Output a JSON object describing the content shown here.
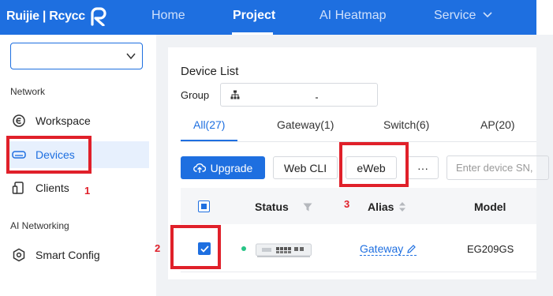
{
  "brand": {
    "logo_text": "Ruijie | Rcycc"
  },
  "topnav": {
    "items": [
      {
        "label": "Home",
        "active": false
      },
      {
        "label": "Project",
        "active": true
      },
      {
        "label": "AI Heatmap",
        "active": false
      },
      {
        "label": "Service",
        "active": false,
        "has_dropdown": true
      }
    ]
  },
  "sidebar": {
    "project_select_value": "",
    "section_network": "Network",
    "items": [
      {
        "label": "Workspace",
        "icon": "workspace-icon",
        "selected": false
      },
      {
        "label": "Devices",
        "icon": "devices-icon",
        "selected": true
      },
      {
        "label": "Clients",
        "icon": "clients-icon",
        "selected": false
      }
    ],
    "section_ai": "AI Networking",
    "ai_items": [
      {
        "label": "Smart Config",
        "icon": "smart-config-icon"
      }
    ]
  },
  "main": {
    "title": "Device List",
    "group_label": "Group",
    "group_value": "",
    "tabs": [
      {
        "label": "All(27)",
        "active": true
      },
      {
        "label": "Gateway(1)",
        "active": false
      },
      {
        "label": "Switch(6)",
        "active": false
      },
      {
        "label": "AP(20)",
        "active": false
      }
    ],
    "toolbar": {
      "upgrade_label": "Upgrade",
      "webcli_label": "Web CLI",
      "eweb_label": "eWeb",
      "more_label": "···",
      "search_placeholder": "Enter device SN,"
    },
    "table": {
      "columns": [
        "Status",
        "Alias",
        "Model"
      ],
      "rows": [
        {
          "checked": true,
          "status": "online",
          "alias": "Gateway",
          "model": "EG209GS"
        }
      ]
    }
  },
  "annotations": {
    "one": "1",
    "two": "2",
    "three": "3"
  },
  "colors": {
    "brand_blue": "#1e6fe0",
    "annotation_red": "#e0202a",
    "online_green": "#28c486"
  }
}
